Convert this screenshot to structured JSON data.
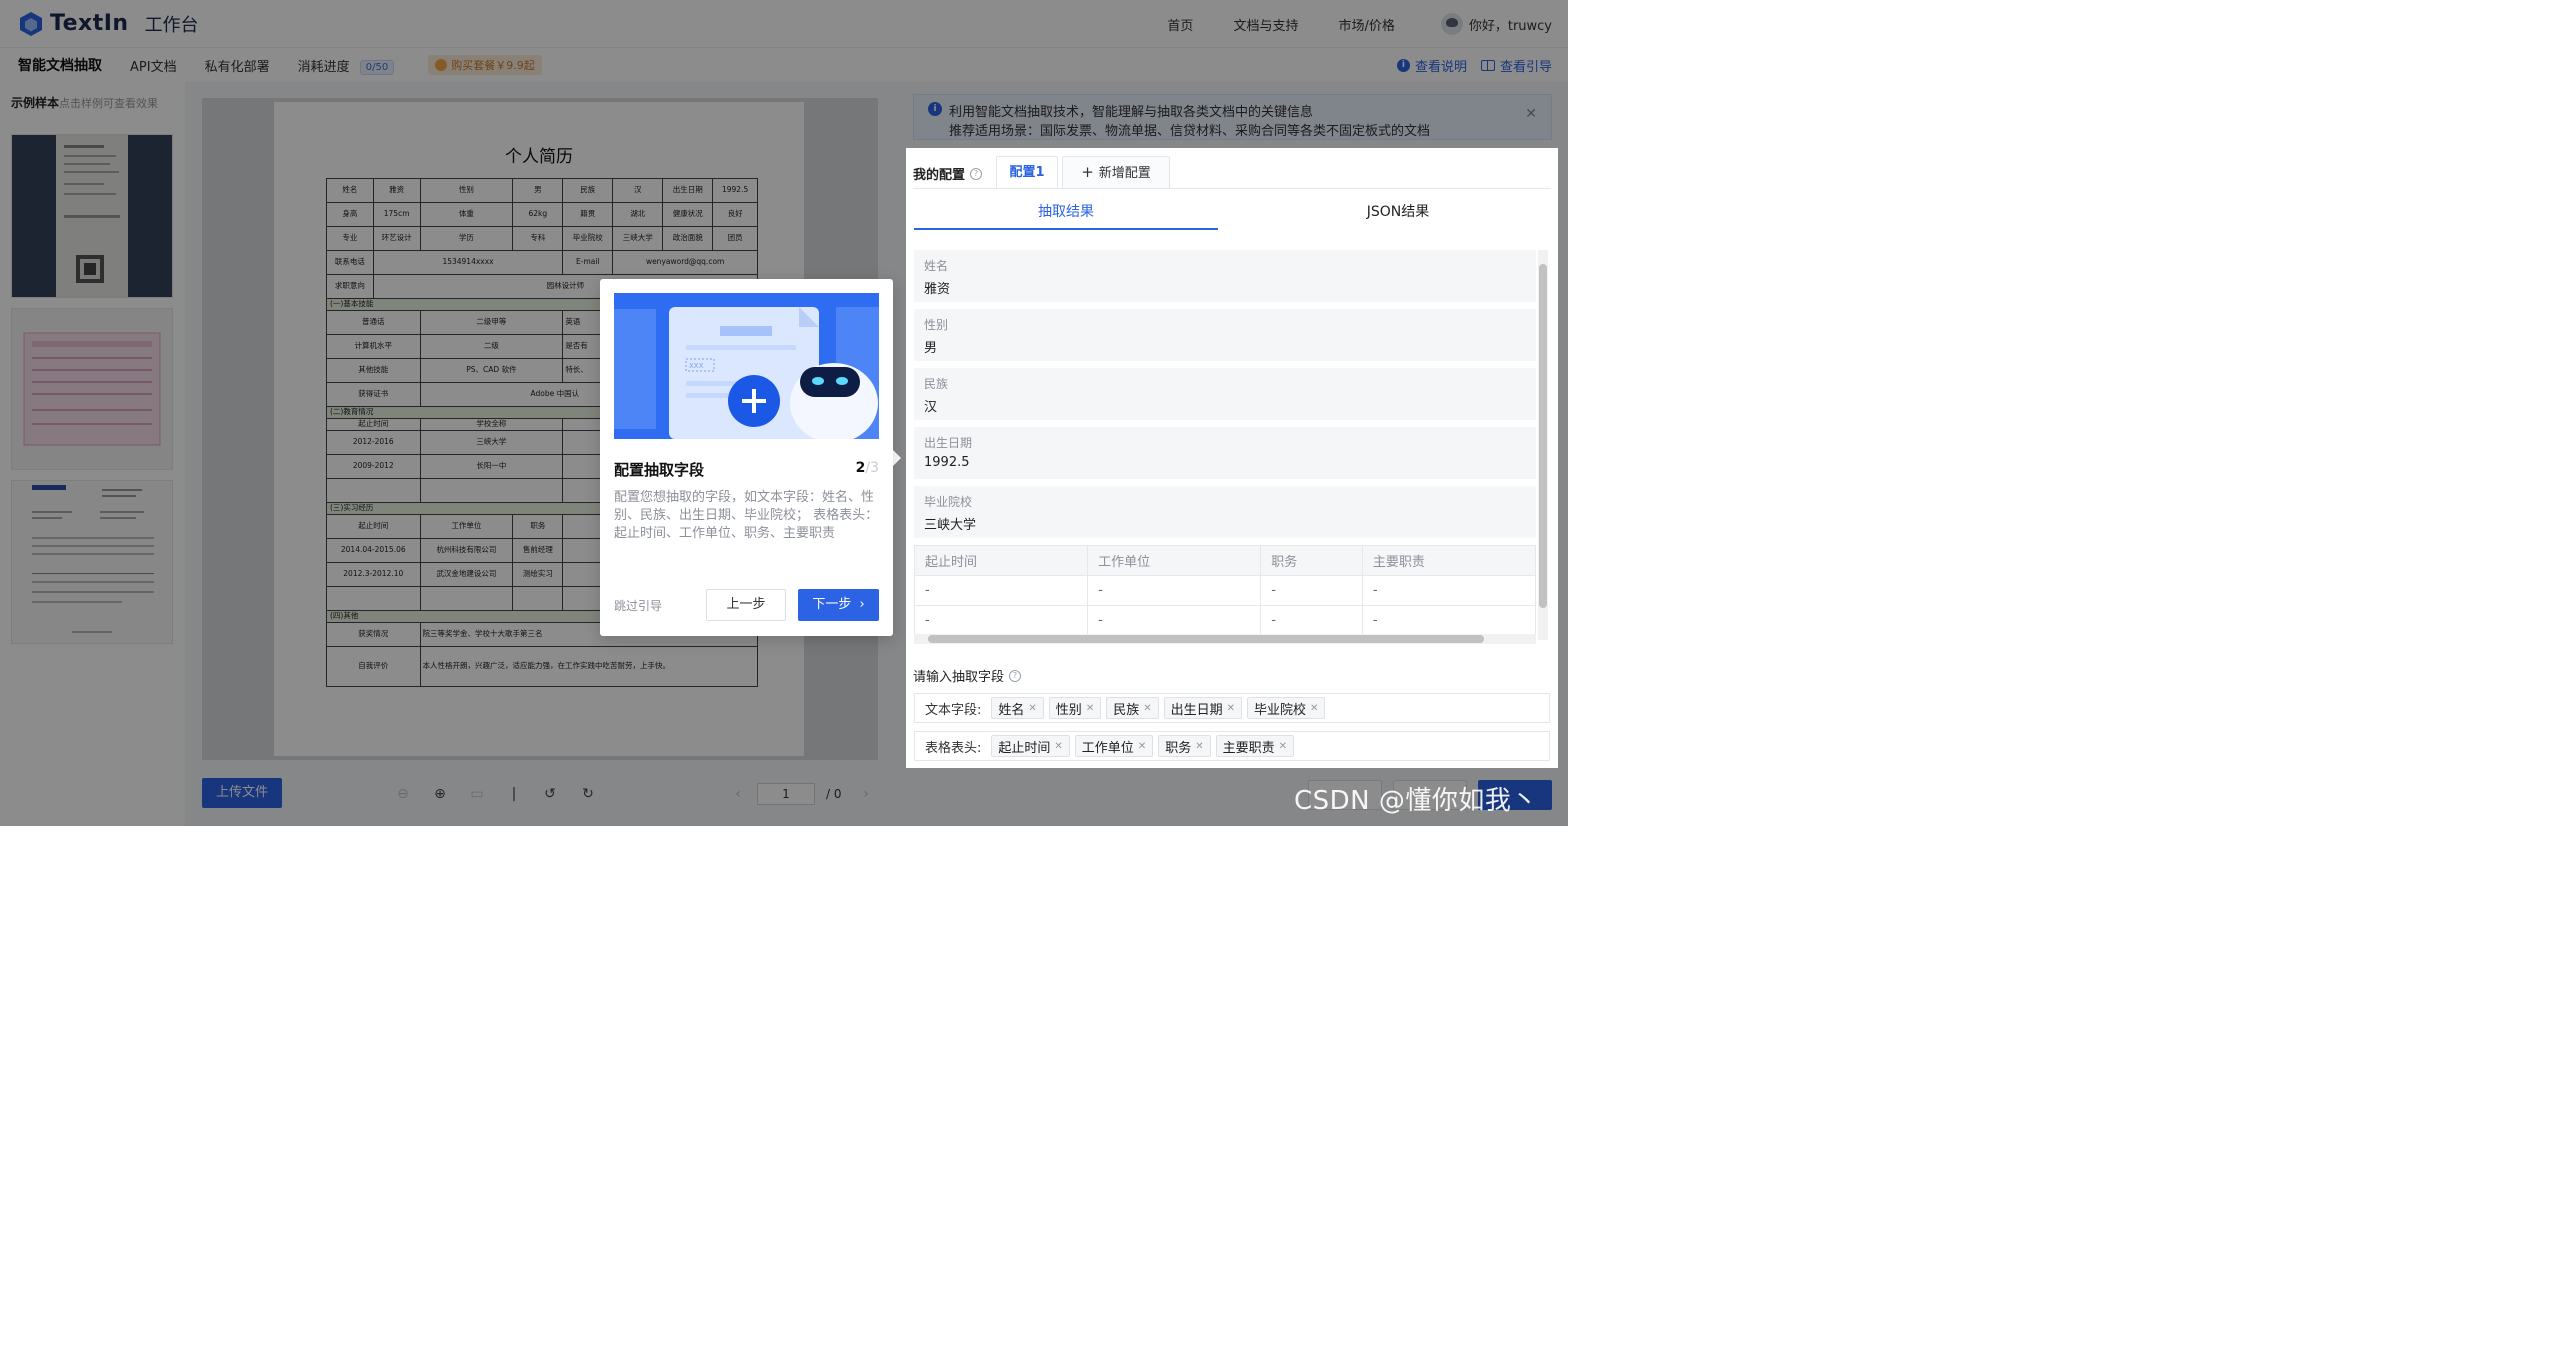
{
  "header": {
    "logo_text": "TextIn",
    "logo_sub": "工作台",
    "nav": [
      "首页",
      "文档与支持",
      "市场/价格"
    ],
    "user_greeting": "你好，truwcy"
  },
  "subnav": {
    "items": [
      "智能文档抽取",
      "API文档",
      "私有化部署",
      "消耗进度"
    ],
    "quota": "0/50",
    "buy": "购买套餐￥9.9起",
    "help_links": [
      "查看说明",
      "查看引导"
    ]
  },
  "samples": {
    "title": "示例样本",
    "hint": "点击样例可查看效果"
  },
  "resume": {
    "title": "个人简历",
    "rows": [
      [
        "姓名",
        "雅资",
        "性别",
        "男",
        "民族",
        "汉",
        "出生日期",
        "1992.5"
      ],
      [
        "身高",
        "175cm",
        "体重",
        "62kg",
        "籍贯",
        "湖北",
        "健康状况",
        "良好"
      ],
      [
        "专业",
        "环艺设计",
        "学历",
        "专科",
        "毕业院校",
        "三峡大学",
        "政治面貌",
        "团员"
      ]
    ],
    "contact_label": "联系电话",
    "contact_phone": "1534914xxxx",
    "email_label": "E-mail",
    "email": "wenyaword@qq.com",
    "intent_label": "求职意向",
    "intent": "园林设计师",
    "sec_skills": "(一)基本技能",
    "skills": [
      [
        "普通话",
        "二级甲等",
        "英语"
      ],
      [
        "计算机水平",
        "二级",
        "是否有"
      ],
      [
        "其他技能",
        "PS、CAD 软件",
        "特长、"
      ],
      [
        "获得证书",
        "Adobe 中国认"
      ]
    ],
    "sec_edu": "(二)教育情况",
    "edu_head": [
      "起止时间",
      "学校全称"
    ],
    "edu": [
      [
        "2012-2016",
        "三峡大学"
      ],
      [
        "2009-2012",
        "长阳一中"
      ]
    ],
    "sec_intern": "(三)实习经历",
    "intern_head": [
      "起止时间",
      "工作单位",
      "职务"
    ],
    "intern": [
      [
        "2014.04-2015.06",
        "杭州科技有限公司",
        "售前经理"
      ],
      [
        "2012.3-2012.10",
        "武汉金地建设公司",
        "测绘实习"
      ]
    ],
    "sec_other": "(四)其他",
    "award_label": "获奖情况",
    "award": "院三等奖学金、学校十大歌手第三名",
    "eval_label": "自我评价",
    "eval": "本人性格开朗，兴趣广泛，适应能力强，在工作实践中吃苦耐劳，上手快。"
  },
  "viewer": {
    "upload_label": "上传文件",
    "page_current": "1",
    "page_total": "/ 0"
  },
  "notice": {
    "line1": "利用智能文档抽取技术，智能理解与抽取各类文档中的关键信息",
    "line2": "推荐适用场景：国际发票、物流单据、信贷材料、采购合同等各类不固定板式的文档"
  },
  "panel": {
    "config_label": "我的配置",
    "config_tab": "配置1",
    "add_config": "新增配置",
    "result_tabs": [
      "抽取结果",
      "JSON结果"
    ],
    "fields": [
      {
        "key": "姓名",
        "value": "雅资"
      },
      {
        "key": "性别",
        "value": "男"
      },
      {
        "key": "民族",
        "value": "汉"
      },
      {
        "key": "出生日期",
        "value": "1992.5"
      },
      {
        "key": "毕业院校",
        "value": "三峡大学"
      }
    ],
    "table_head": [
      "起止时间",
      "工作单位",
      "职务",
      "主要职责"
    ],
    "table_rows": [
      [
        "-",
        "-",
        "-",
        "-"
      ],
      [
        "-",
        "-",
        "-",
        "-"
      ]
    ],
    "input_label": "请输入抽取字段",
    "text_label": "文本字段:",
    "text_chips": [
      "姓名",
      "性别",
      "民族",
      "出生日期",
      "毕业院校"
    ],
    "table_label": "表格表头:",
    "table_chips": [
      "起止时间",
      "工作单位",
      "职务",
      "主要职责"
    ]
  },
  "guide": {
    "title": "配置抽取字段",
    "step": "2",
    "step_total": "/3",
    "desc": "配置您想抽取的字段，如文本字段：姓名、性别、民族、出生日期、毕业院校；  表格表头：起止时间、工作单位、职务、主要职责",
    "skip": "跳过引导",
    "prev": "上一步",
    "next": "下一步",
    "illus_tag": "XXX"
  },
  "watermark": "CSDN @懂你如我丶",
  "colors": {
    "primary": "#2c63e4",
    "overlay": "rgba(0,0,0,0.45)"
  }
}
